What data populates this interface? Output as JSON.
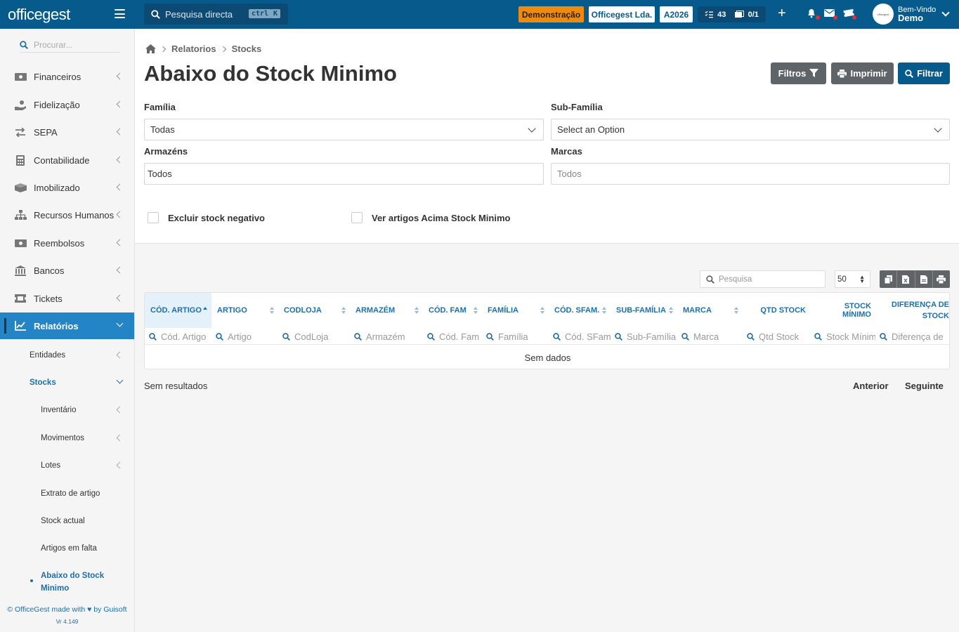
{
  "topbar": {
    "logo": "officegest",
    "search_placeholder": "Pesquisa directa",
    "shortcut_key1": "ctrl",
    "shortcut_key2": "K",
    "tag_demo": "Demonstração",
    "tag_company": "Officegest Lda.",
    "tag_year": "A2026",
    "tasks_count": "43",
    "docs_count": "0/1",
    "user_greeting": "Bem-Vindo",
    "user_name": "Demo",
    "accent_color": "#065a8c",
    "demo_color": "#f08a0b"
  },
  "sidebar": {
    "search_placeholder": "Procurar...",
    "items": [
      {
        "label": "Financeiros",
        "icon": "money-icon"
      },
      {
        "label": "Fidelização",
        "icon": "hand-coin-icon"
      },
      {
        "label": "SEPA",
        "icon": "transfer-icon"
      },
      {
        "label": "Contabilidade",
        "icon": "calculator-icon"
      },
      {
        "label": "Imobilizado",
        "icon": "boxes-icon"
      },
      {
        "label": "Recursos Humanos",
        "icon": "org-chart-icon"
      },
      {
        "label": "Reembolsos",
        "icon": "money-icon"
      },
      {
        "label": "Bancos",
        "icon": "bank-icon"
      },
      {
        "label": "Tickets",
        "icon": "ticket-icon"
      },
      {
        "label": "Relatórios",
        "icon": "chart-icon"
      }
    ],
    "sub_items": [
      "Entidades",
      "Stocks"
    ],
    "stocks_items": [
      "Inventário",
      "Movimentos",
      "Lotes",
      "Extrato de artigo",
      "Stock actual",
      "Artigos em falta"
    ],
    "current_line1": "Abaixo do Stock",
    "current_line2": "Minimo",
    "footer": "© OfficeGest made with",
    "footer_by": "by Guisoft",
    "version": "Vr 4.149"
  },
  "breadcrumb": [
    "Relatorios",
    "Stocks"
  ],
  "page_title": "Abaixo do Stock Minimo",
  "actions": {
    "filtros": "Filtros",
    "imprimir": "Imprimir",
    "filtrar": "Filtrar"
  },
  "filters": {
    "familia_label": "Família",
    "familia_value": "Todas",
    "subfamilia_label": "Sub-Família",
    "subfamilia_value": "Select an Option",
    "armazens_label": "Armazéns",
    "armazens_value": "Todos",
    "marcas_label": "Marcas",
    "marcas_placeholder": "Todos",
    "excluir_label": "Excluir stock negativo",
    "ver_label": "Ver artigos Acima Stock Minimo"
  },
  "table": {
    "search_placeholder": "Pesquisa",
    "page_size": "50",
    "columns": [
      "CÓD. ARTIGO",
      "ARTIGO",
      "CODLOJA",
      "ARMAZÉM",
      "CÓD. FAM",
      "FAMÍLIA",
      "CÓD. SFAM.",
      "SUB-FAMÍLIA",
      "MARCA",
      "QTD STOCK",
      "STOCK MÍNIMO",
      "DIFERENÇA DE",
      "STOCK"
    ],
    "filter_placeholders": [
      "Cód. Artigo",
      "Artigo",
      "CodLoja",
      "Armazém",
      "Cód. Fam",
      "Família",
      "Cód. SFam",
      "Sub-Família",
      "Marca",
      "Qtd Stock",
      "Stock Mínimo",
      "Diferença de"
    ],
    "empty_text": "Sem dados",
    "results_text": "Sem resultados",
    "prev": "Anterior",
    "next": "Seguinte"
  }
}
